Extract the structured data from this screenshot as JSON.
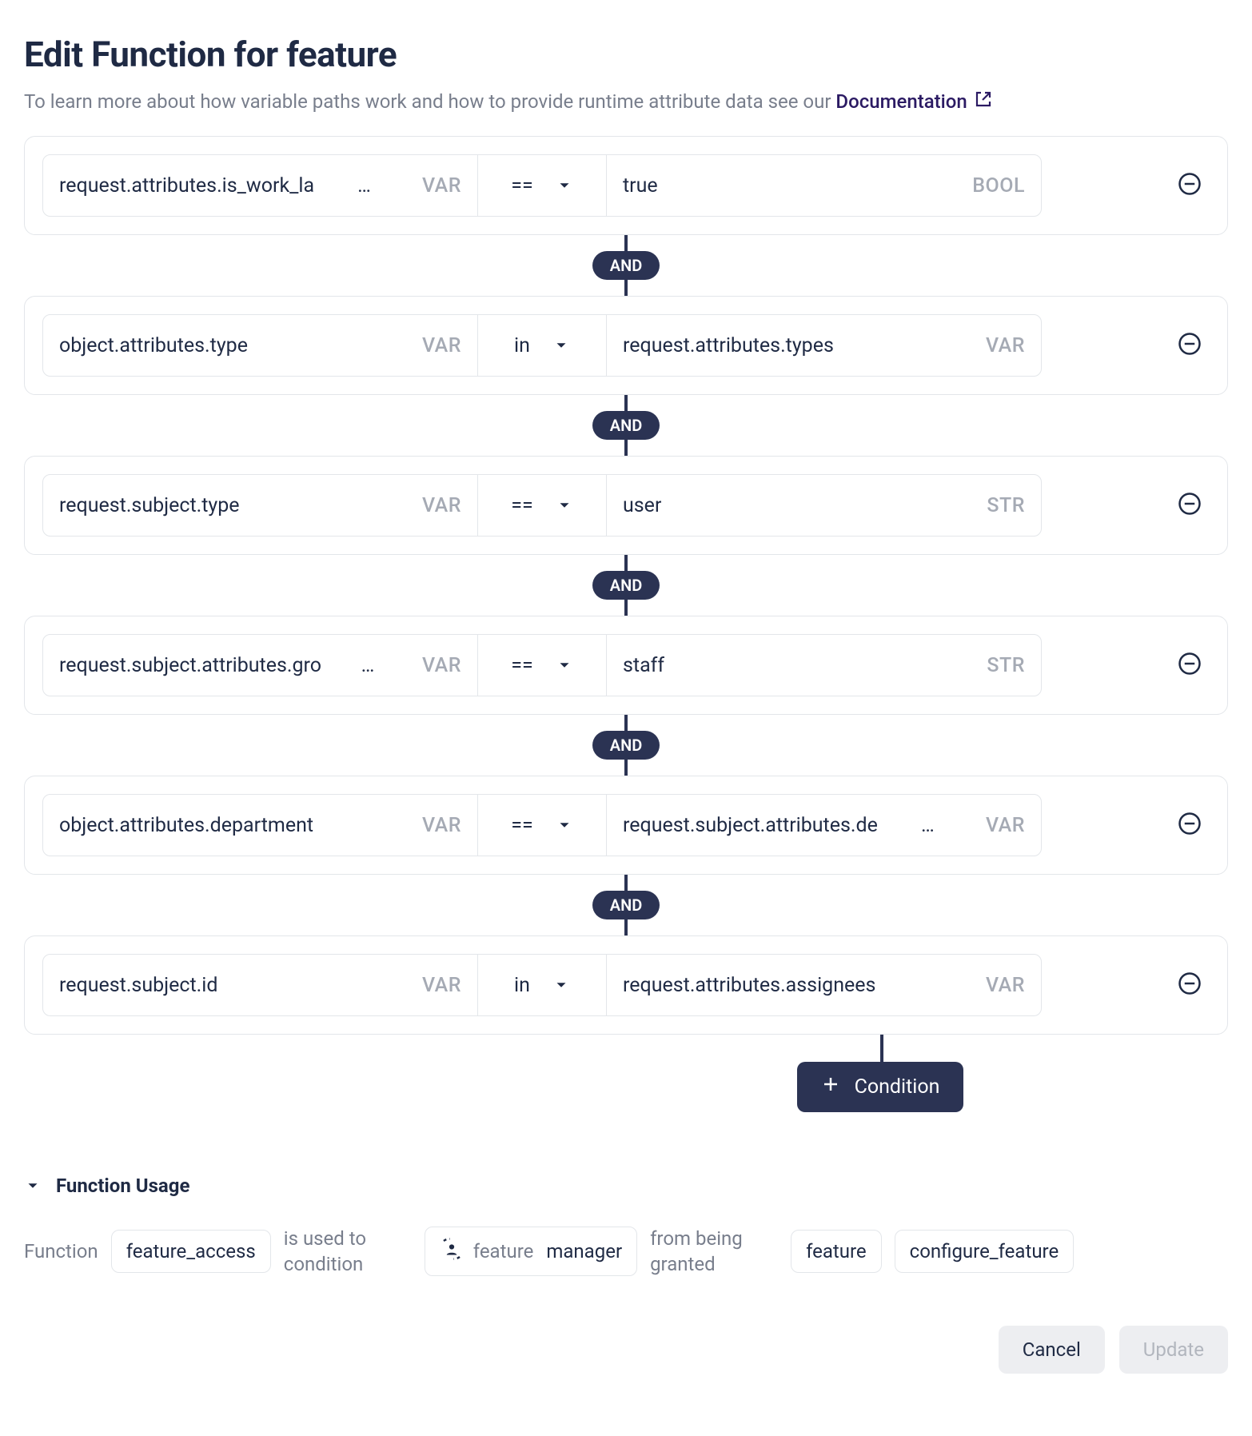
{
  "header": {
    "title": "Edit Function for feature",
    "subtitle_prefix": "To learn more about how variable paths work and how to provide runtime attribute data see our ",
    "doc_link_label": "Documentation"
  },
  "connector_label": "AND",
  "add_condition_label": "Condition",
  "conditions": [
    {
      "lhs_text": "request.attributes.is_work_la",
      "lhs_trunc": true,
      "lhs_tag": "VAR",
      "op": "==",
      "rhs_text": "true",
      "rhs_trunc": false,
      "rhs_tag": "BOOL"
    },
    {
      "lhs_text": "object.attributes.type",
      "lhs_trunc": false,
      "lhs_tag": "VAR",
      "op": "in",
      "rhs_text": "request.attributes.types",
      "rhs_trunc": false,
      "rhs_tag": "VAR"
    },
    {
      "lhs_text": "request.subject.type",
      "lhs_trunc": false,
      "lhs_tag": "VAR",
      "op": "==",
      "rhs_text": "user",
      "rhs_trunc": false,
      "rhs_tag": "STR"
    },
    {
      "lhs_text": "request.subject.attributes.gro",
      "lhs_trunc": true,
      "lhs_tag": "VAR",
      "op": "==",
      "rhs_text": "staff",
      "rhs_trunc": false,
      "rhs_tag": "STR"
    },
    {
      "lhs_text": "object.attributes.department",
      "lhs_trunc": false,
      "lhs_tag": "VAR",
      "op": "==",
      "rhs_text": "request.subject.attributes.de",
      "rhs_trunc": true,
      "rhs_tag": "VAR"
    },
    {
      "lhs_text": "request.subject.id",
      "lhs_trunc": false,
      "lhs_tag": "VAR",
      "op": "in",
      "rhs_text": "request.attributes.assignees",
      "rhs_trunc": false,
      "rhs_tag": "VAR"
    }
  ],
  "usage": {
    "section_title": "Function Usage",
    "function_label": "Function",
    "function_name": "feature_access",
    "phrase1": "is used to condition",
    "rel_sub": "feature",
    "rel_main": "manager",
    "phrase2": "from being granted",
    "obj1": "feature",
    "obj2": "configure_feature"
  },
  "footer": {
    "cancel": "Cancel",
    "update": "Update"
  }
}
